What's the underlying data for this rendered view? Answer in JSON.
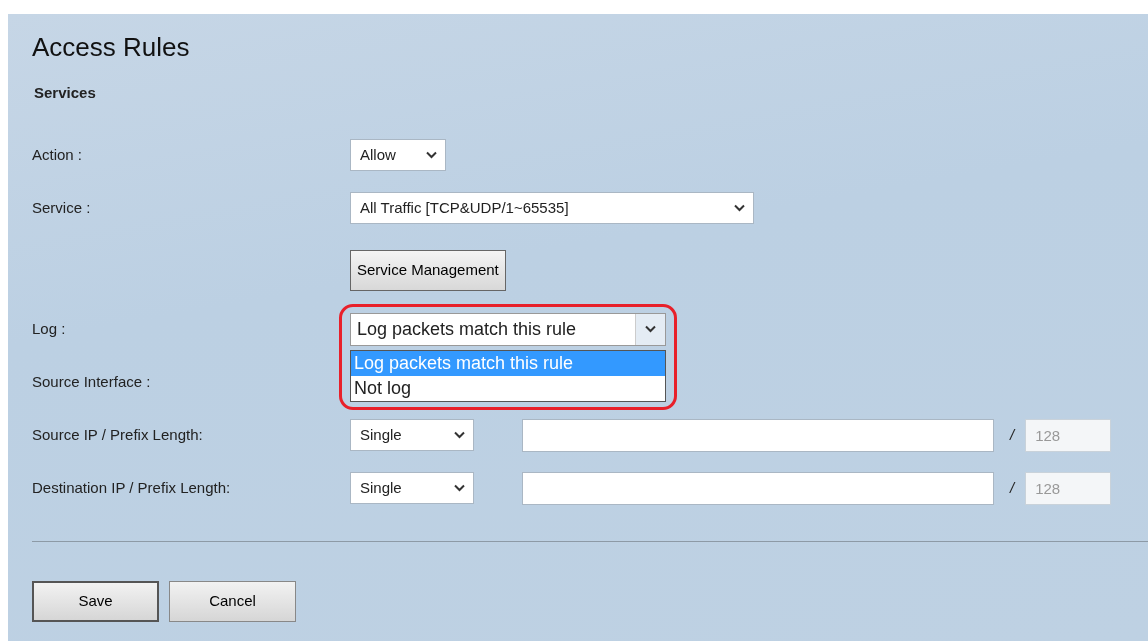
{
  "title": "Access Rules",
  "section": "Services",
  "fields": [
    {
      "kind": "select",
      "label": "Action :",
      "value": "Allow"
    },
    {
      "kind": "wide_select",
      "label": "Service :",
      "value": "All Traffic [TCP&UDP/1~65535]"
    },
    {
      "kind": "button",
      "label": "Service Management"
    },
    {
      "kind": "open_select",
      "label": "Log :",
      "value": "Log packets match this rule",
      "highlighted": true,
      "options": [
        {
          "label": "Log packets match this rule",
          "selected": true
        },
        {
          "label": "Not log",
          "selected": false
        }
      ]
    },
    {
      "kind": "label_only",
      "label": "Source Interface :"
    },
    {
      "kind": "ip",
      "label": "Source IP / Prefix Length:",
      "value": "Single",
      "separator": "/",
      "prefix": "128",
      "prefix_disabled": true
    },
    {
      "kind": "ip",
      "label": "Destination IP / Prefix Length:",
      "value": "Single",
      "separator": "/",
      "prefix": "128",
      "prefix_disabled": true
    }
  ],
  "buttons": [
    {
      "label": "Save",
      "default": true
    },
    {
      "label": "Cancel",
      "default": false
    }
  ]
}
